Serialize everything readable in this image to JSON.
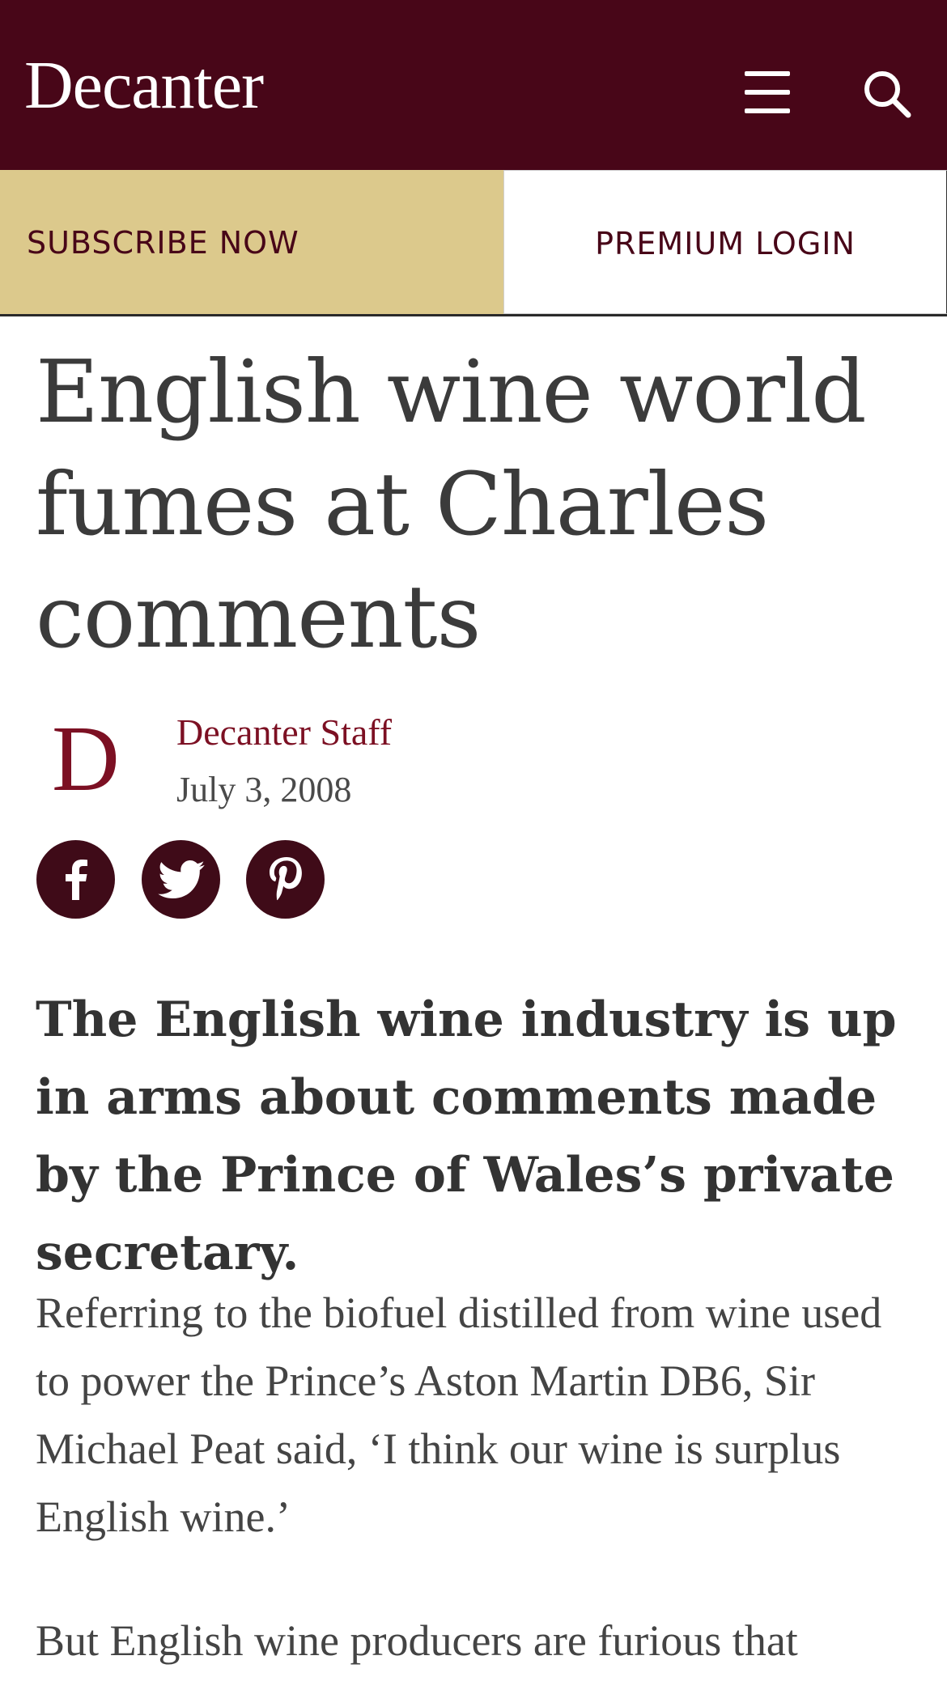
{
  "header": {
    "logo_text": "Decanter",
    "menu_icon": "hamburger-menu-icon",
    "search_icon": "search-icon",
    "background": "#480618"
  },
  "cta": {
    "subscribe_label": "SUBSCRIBE NOW",
    "premium_label": "PREMIUM LOGIN",
    "subscribe_bg": "#dcc98c"
  },
  "article": {
    "title": "English wine world fumes at Charles comments",
    "author_initial": "D",
    "author": "Decanter Staff",
    "date": "July 3, 2008",
    "share": [
      {
        "name": "facebook",
        "icon": "facebook-icon"
      },
      {
        "name": "twitter",
        "icon": "twitter-icon"
      },
      {
        "name": "pinterest",
        "icon": "pinterest-icon"
      }
    ],
    "standfirst": "The English wine industry is up in arms about comments made by the Prince of Wales’s private secretary.",
    "paragraphs": [
      "Referring to the biofuel distilled from wine used to power the Prince’s Aston Martin DB6, Sir Michael Peat said, ‘I think our wine is surplus English wine.’",
      "But English wine producers are furious that"
    ]
  }
}
